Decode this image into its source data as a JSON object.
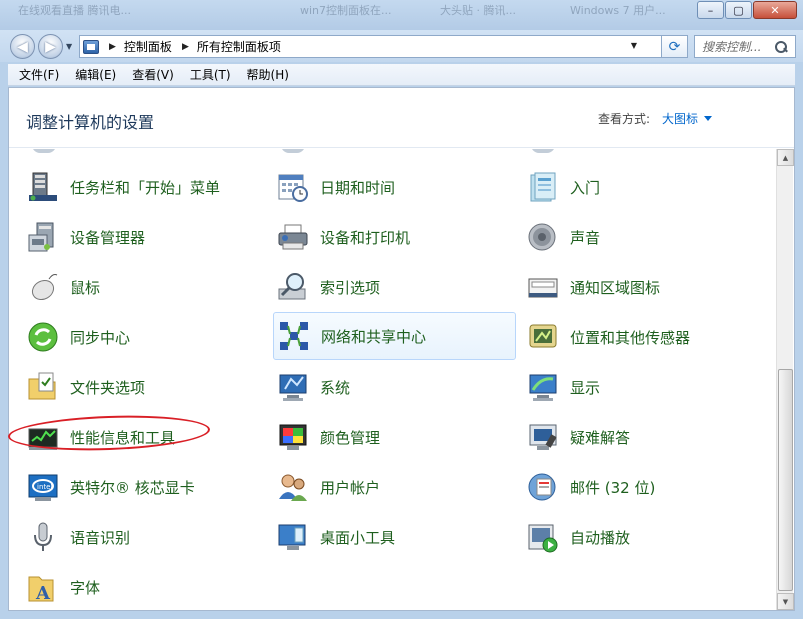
{
  "window": {
    "background_tabs": [
      "在线观看直播 腾讯电...",
      "win7控制面板在...",
      "大头贴 · 腾讯...",
      "Windows 7 用户..."
    ],
    "buttons": {
      "minimize": "–",
      "maximize": "▢",
      "close": "✕"
    }
  },
  "address": {
    "breadcrumbs": [
      "控制面板",
      "所有控制面板项"
    ],
    "search_placeholder": "搜索控制...",
    "refresh_glyph": "⟳"
  },
  "menu": [
    "文件(F)",
    "编辑(E)",
    "查看(V)",
    "工具(T)",
    "帮助(H)"
  ],
  "header": {
    "title": "调整计算机的设置",
    "view_by_label": "查看方式:",
    "view_by_value": "大图标"
  },
  "items": [
    {
      "label": "任务栏和「开始」菜单",
      "icon": "taskbar-icon"
    },
    {
      "label": "日期和时间",
      "icon": "calendar-clock-icon"
    },
    {
      "label": "入门",
      "icon": "getting-started-icon"
    },
    {
      "label": "设备管理器",
      "icon": "device-manager-icon"
    },
    {
      "label": "设备和打印机",
      "icon": "printer-icon"
    },
    {
      "label": "声音",
      "icon": "speaker-icon"
    },
    {
      "label": "鼠标",
      "icon": "mouse-icon"
    },
    {
      "label": "索引选项",
      "icon": "index-magnifier-icon"
    },
    {
      "label": "通知区域图标",
      "icon": "notification-icon"
    },
    {
      "label": "同步中心",
      "icon": "sync-icon"
    },
    {
      "label": "网络和共享中心",
      "icon": "network-icon"
    },
    {
      "label": "位置和其他传感器",
      "icon": "sensor-icon"
    },
    {
      "label": "文件夹选项",
      "icon": "folder-options-icon"
    },
    {
      "label": "系统",
      "icon": "system-icon"
    },
    {
      "label": "显示",
      "icon": "display-icon"
    },
    {
      "label": "性能信息和工具",
      "icon": "performance-icon"
    },
    {
      "label": "颜色管理",
      "icon": "color-management-icon"
    },
    {
      "label": "疑难解答",
      "icon": "troubleshoot-icon"
    },
    {
      "label": "英特尔® 核芯显卡",
      "icon": "intel-graphics-icon"
    },
    {
      "label": "用户帐户",
      "icon": "user-accounts-icon"
    },
    {
      "label": "邮件 (32 位)",
      "icon": "mail-icon"
    },
    {
      "label": "语音识别",
      "icon": "microphone-icon"
    },
    {
      "label": "桌面小工具",
      "icon": "gadgets-icon"
    },
    {
      "label": "自动播放",
      "icon": "autoplay-icon"
    },
    {
      "label": "字体",
      "icon": "fonts-icon"
    }
  ],
  "colors": {
    "link_green": "#1e5f1e",
    "title_blue": "#1e395b",
    "accent_blue": "#0066cc",
    "annotation_red": "#d91f26"
  }
}
